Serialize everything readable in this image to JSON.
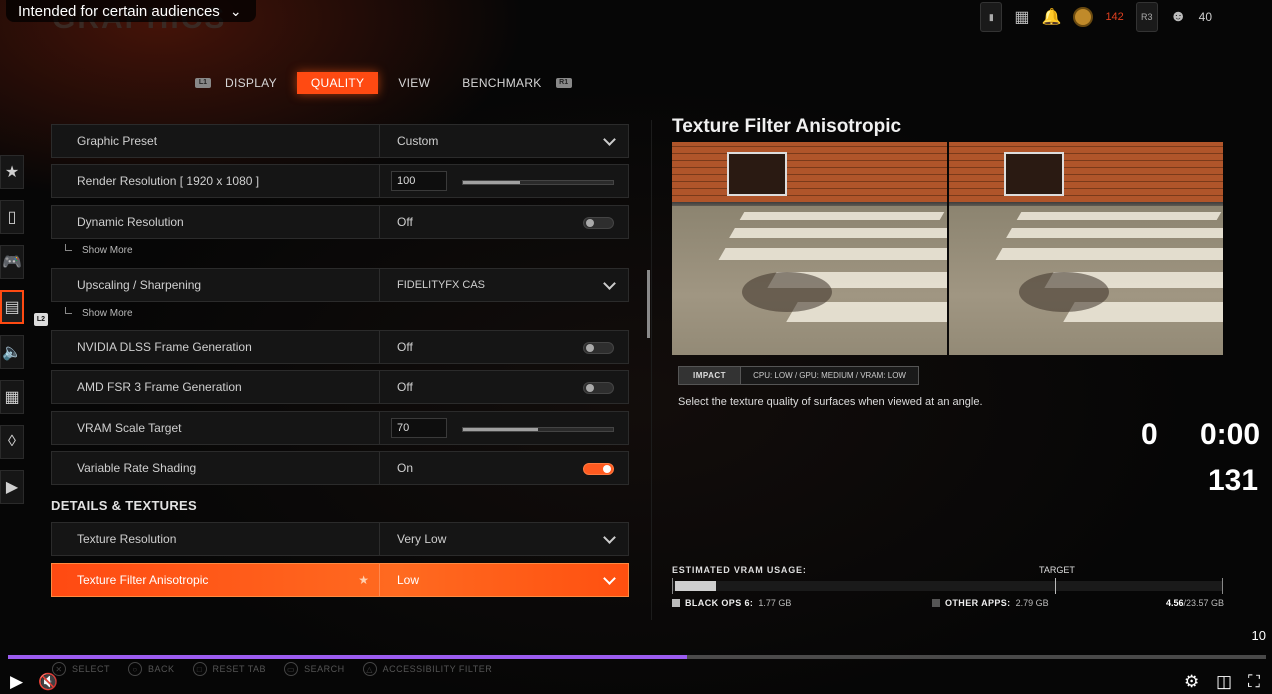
{
  "overlay": {
    "audience_text": "Intended for certain audiences"
  },
  "header": {
    "title": "GRAPHICS",
    "xp_red": "142",
    "player_count": "40",
    "r3_label": "R3"
  },
  "tabs": [
    {
      "label": "DISPLAY",
      "active": false
    },
    {
      "label": "QUALITY",
      "active": true
    },
    {
      "label": "VIEW",
      "active": false
    },
    {
      "label": "BENCHMARK",
      "active": false
    }
  ],
  "tab_badges": {
    "left": "L1",
    "right": "R1"
  },
  "side_badge": "L2",
  "settings": {
    "graphic_preset": {
      "label": "Graphic Preset",
      "value": "Custom"
    },
    "render_resolution": {
      "label": "Render Resolution [ 1920 x 1080 ]",
      "value": "100",
      "level": 0.38
    },
    "dynamic_resolution": {
      "label": "Dynamic Resolution",
      "value": "Off"
    },
    "show_more_1": "Show More",
    "upscaling": {
      "label": "Upscaling / Sharpening",
      "value": "FIDELITYFX CAS"
    },
    "show_more_2": "Show More",
    "dlss_frame_gen": {
      "label": "NVIDIA DLSS Frame Generation",
      "value": "Off"
    },
    "fsr3_frame_gen": {
      "label": "AMD FSR 3 Frame Generation",
      "value": "Off"
    },
    "vram_scale": {
      "label": "VRAM Scale Target",
      "value": "70",
      "level": 0.5
    },
    "vrs": {
      "label": "Variable Rate Shading",
      "value": "On"
    },
    "section_details": "DETAILS & TEXTURES",
    "texture_resolution": {
      "label": "Texture Resolution",
      "value": "Very Low"
    },
    "texture_filter": {
      "label": "Texture Filter Anisotropic",
      "value": "Low"
    }
  },
  "panel": {
    "title": "Texture Filter Anisotropic",
    "impact_key": "IMPACT",
    "impact_value": "CPU: LOW / GPU: MEDIUM / VRAM: LOW",
    "description": "Select the texture quality of surfaces when viewed at an angle."
  },
  "overlay_stats": {
    "score": "0",
    "time": "0:00",
    "count": "131"
  },
  "vram": {
    "label": "ESTIMATED VRAM USAGE:",
    "target_label": "TARGET",
    "bo6_label": "BLACK OPS 6:",
    "bo6_value": "1.77 GB",
    "other_label": "OTHER APPS:",
    "other_value": "2.79 GB",
    "total_used": "4.56",
    "total_rest": "/23.57 GB",
    "used_fraction": 0.075,
    "target_fraction": 0.695
  },
  "hints": [
    "SELECT",
    "BACK",
    "RESET TAB",
    "SEARCH",
    "ACCESSIBILITY FILTER"
  ],
  "player": {
    "played_fraction": 0.54,
    "ten_label": "10"
  },
  "colors": {
    "accent": "#ff4a12",
    "progress": "#9b5cf0"
  }
}
